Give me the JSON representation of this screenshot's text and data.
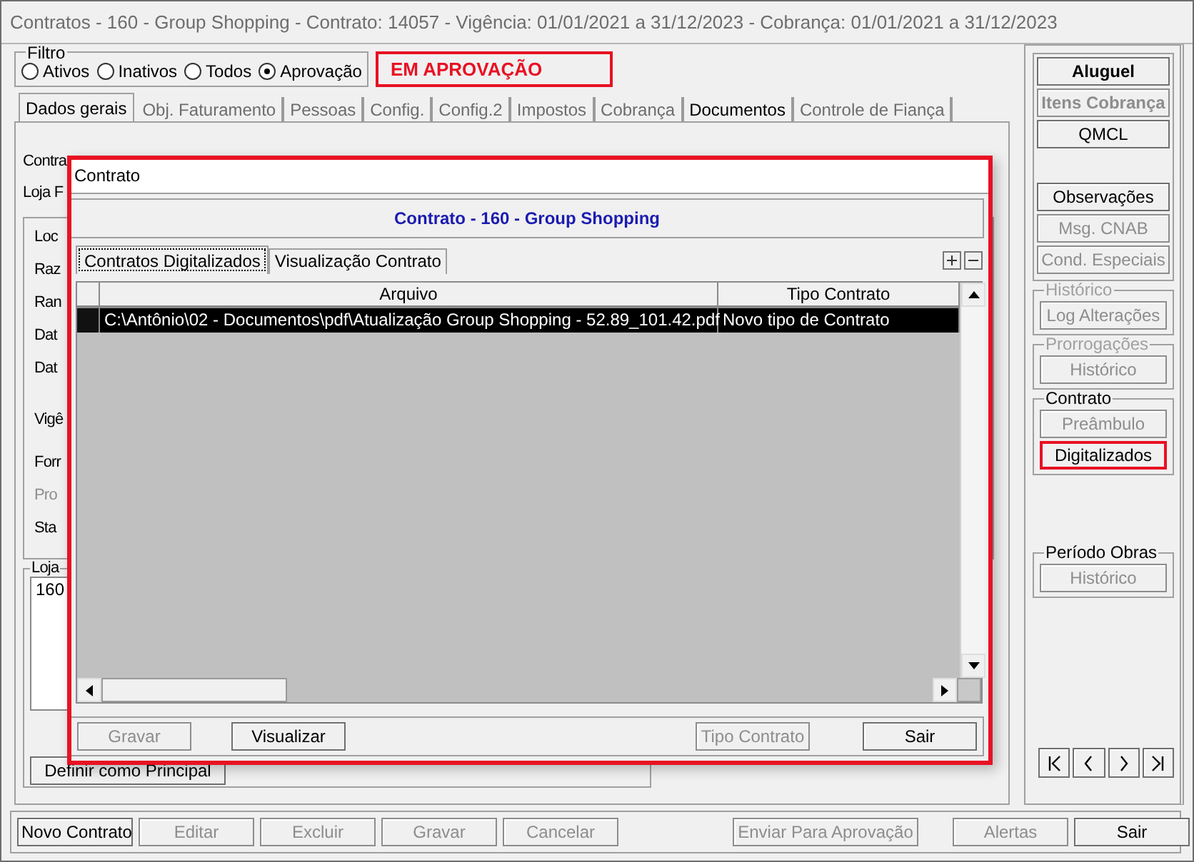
{
  "window": {
    "title": "Contratos - 160 - Group Shopping - Contrato: 14057 - Vigência: 01/01/2021 a 31/12/2023 - Cobrança: 01/01/2021 a 31/12/2023"
  },
  "filter": {
    "legend": "Filtro",
    "options": [
      {
        "label": "Ativos",
        "selected": false
      },
      {
        "label": "Inativos",
        "selected": false
      },
      {
        "label": "Todos",
        "selected": false
      },
      {
        "label": "Aprovação",
        "selected": true
      }
    ]
  },
  "status_label": "EM APROVAÇÃO",
  "tabs": [
    {
      "label": "Dados gerais",
      "selected": true,
      "disabled": false
    },
    {
      "label": "Obj. Faturamento",
      "selected": false,
      "disabled": true
    },
    {
      "label": "Pessoas",
      "selected": false,
      "disabled": true
    },
    {
      "label": "Config.",
      "selected": false,
      "disabled": true
    },
    {
      "label": "Config.2",
      "selected": false,
      "disabled": true
    },
    {
      "label": "Impostos",
      "selected": false,
      "disabled": true
    },
    {
      "label": "Cobrança",
      "selected": false,
      "disabled": true
    },
    {
      "label": "Documentos",
      "selected": false,
      "disabled": false
    },
    {
      "label": "Controle de Fiança",
      "selected": false,
      "disabled": true
    }
  ],
  "form": {
    "fields": [
      {
        "label": "Contra",
        "disabled": false
      },
      {
        "label": "Loja F",
        "disabled": false
      }
    ],
    "details_labels": [
      {
        "label": "Loc",
        "disabled": false
      },
      {
        "label": "Raz",
        "disabled": false
      },
      {
        "label": "Ran",
        "disabled": false
      },
      {
        "label": "Dat",
        "disabled": false
      },
      {
        "label": "Dat",
        "disabled": false
      },
      {
        "label": "Vigê",
        "disabled": false
      },
      {
        "label": "Forr",
        "disabled": false
      },
      {
        "label": "Pro",
        "disabled": true
      },
      {
        "label": "Sta",
        "disabled": false
      }
    ],
    "store_group": {
      "legend": "Loja",
      "items": [
        "160"
      ],
      "button": "Definir como Principal"
    }
  },
  "side_panel": {
    "buttons": [
      {
        "label": "Aluguel",
        "disabled": false,
        "bold": true
      },
      {
        "label": "Itens Cobrança",
        "disabled": true,
        "bold": true
      },
      {
        "label": "QMCL",
        "disabled": false,
        "bold": false
      },
      {
        "label": "Observações",
        "disabled": false,
        "bold": false
      },
      {
        "label": "Msg. CNAB",
        "disabled": true,
        "bold": false
      },
      {
        "label": "Cond. Especiais",
        "disabled": true,
        "bold": false
      }
    ],
    "groups": [
      {
        "legend": "Histórico",
        "disabled": true,
        "buttons": [
          {
            "label": "Log Alterações",
            "disabled": true,
            "highlighted": false
          }
        ]
      },
      {
        "legend": "Prorrogações",
        "disabled": true,
        "buttons": [
          {
            "label": "Histórico",
            "disabled": true,
            "highlighted": false
          }
        ]
      },
      {
        "legend": "Contrato",
        "disabled": false,
        "buttons": [
          {
            "label": "Preâmbulo",
            "disabled": true,
            "highlighted": false
          },
          {
            "label": "Digitalizados",
            "disabled": false,
            "highlighted": true
          }
        ]
      },
      {
        "legend": "Período Obras",
        "disabled": false,
        "buttons": [
          {
            "label": "Histórico",
            "disabled": true,
            "highlighted": false
          }
        ]
      }
    ]
  },
  "footer_buttons": [
    {
      "label": "Novo Contrato",
      "disabled": false
    },
    {
      "label": "Editar",
      "disabled": true
    },
    {
      "label": "Excluir",
      "disabled": true
    },
    {
      "label": "Gravar",
      "disabled": true
    },
    {
      "label": "Cancelar",
      "disabled": true
    },
    {
      "label": "Enviar Para Aprovação",
      "disabled": true
    },
    {
      "label": "Alertas",
      "disabled": true
    },
    {
      "label": "Sair",
      "disabled": false
    }
  ],
  "dialog": {
    "title": "Contrato",
    "header": "Contrato - 160 - Group Shopping",
    "tabs": [
      {
        "label": "Contratos Digitalizados",
        "selected": true
      },
      {
        "label": "Visualização Contrato",
        "selected": false
      }
    ],
    "table": {
      "columns": [
        "Arquivo",
        "Tipo Contrato"
      ],
      "rows": [
        {
          "cells": [
            "C:\\Antônio\\02 - Documentos\\pdf\\Atualização Group Shopping - 52.89_101.42.pdf",
            "Novo tipo de Contrato"
          ],
          "selected": true
        }
      ]
    },
    "buttons": [
      {
        "label": "Gravar",
        "disabled": true
      },
      {
        "label": "Visualizar",
        "disabled": false
      },
      {
        "label": "Tipo Contrato",
        "disabled": true
      },
      {
        "label": "Sair",
        "disabled": false
      }
    ]
  }
}
